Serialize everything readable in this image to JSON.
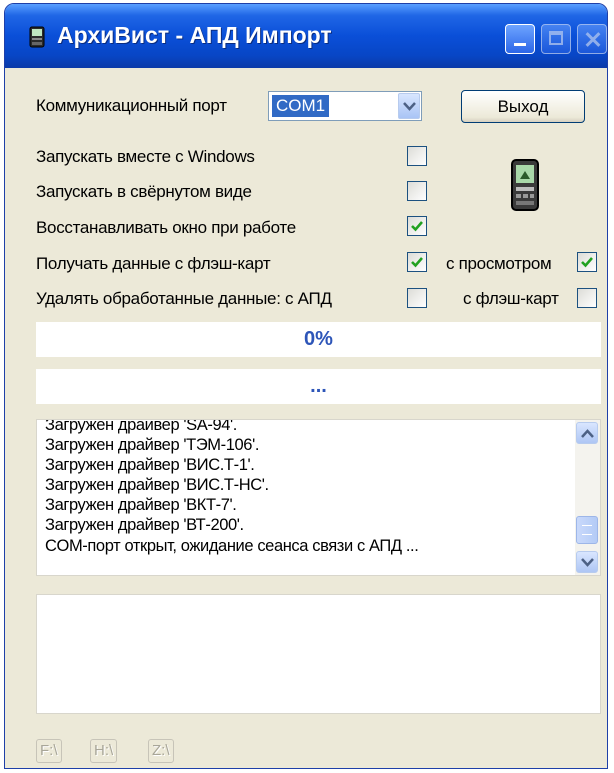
{
  "window": {
    "title": "АрхиВист - АПД Импорт"
  },
  "form": {
    "port_label": "Коммуникационный порт",
    "port_value": "COM1",
    "exit_label": "Выход",
    "checkboxes": [
      {
        "label": "Запускать вместе с Windows",
        "checked": false
      },
      {
        "label": "Запускать в свёрнутом виде",
        "checked": false
      },
      {
        "label": "Восстанавливать окно при работе",
        "checked": true
      },
      {
        "label": "Получать данные с флэш-карт",
        "checked": true
      },
      {
        "label": "Удалять обработанные данные:  с АПД",
        "checked": false
      }
    ],
    "view_label": "с просмотром",
    "view_checked": true,
    "flash_label": "с флэш-карт",
    "flash_checked": false
  },
  "progress": {
    "percent_text": "0%",
    "status_text": "..."
  },
  "log": {
    "lines": [
      "Загружен драйвер 'SA-94'.",
      "Загружен драйвер 'ТЭМ-106'.",
      "Загружен драйвер 'ВИС.Т-1'.",
      "Загружен драйвер 'ВИС.Т-НС'.",
      "Загружен драйвер 'ВКТ-7'.",
      "Загружен драйвер 'ВТ-200'.",
      "COM-порт открыт, ожидание сеанса связи с АПД ..."
    ]
  },
  "drives": [
    "F:\\",
    "H:\\",
    "Z:\\"
  ],
  "icons": {
    "app": "app-icon",
    "device": "pda-device-icon"
  }
}
